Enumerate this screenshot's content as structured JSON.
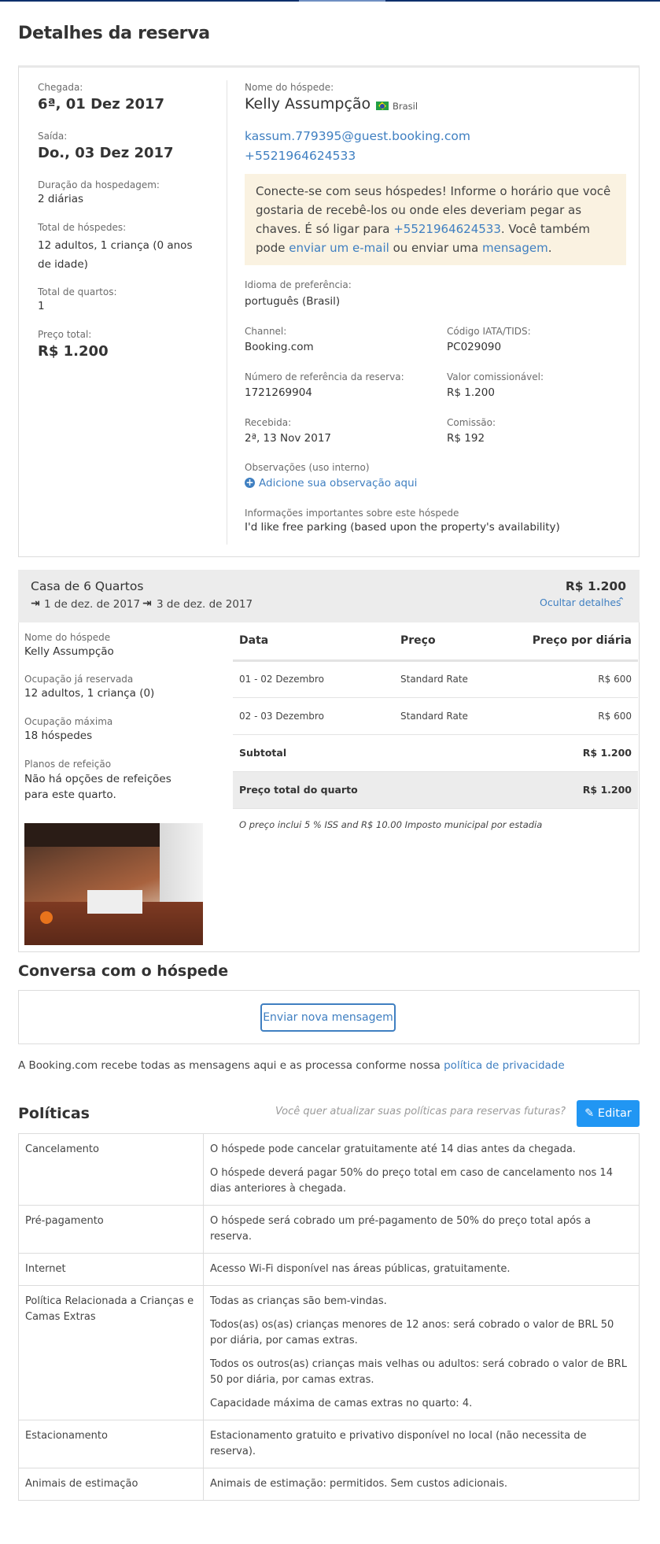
{
  "page_title": "Detalhes da reserva",
  "reservation": {
    "arrival_label": "Chegada:",
    "arrival_value": "6ª, 01 Dez 2017",
    "departure_label": "Saída:",
    "departure_value": "Do., 03 Dez 2017",
    "duration_label": "Duração da hospedagem:",
    "duration_value": "2 diárias",
    "guests_label": "Total de hóspedes:",
    "guests_value": "12 adultos, 1 criança (0 anos de idade)",
    "rooms_label": "Total de quartos:",
    "rooms_value": "1",
    "price_label": "Preço total:",
    "price_value": "R$ 1.200"
  },
  "guest": {
    "name_label": "Nome do hóspede:",
    "name": "Kelly Assumpção",
    "country": "Brasil",
    "email": "kassum.779395@guest.booking.com",
    "phone": "+5521964624533",
    "notice_pre": "Conecte-se com seus hóspedes! Informe o horário que você gostaria de recebê-los ou onde eles deveriam pegar as chaves. É só ligar para ",
    "notice_phone": "+5521964624533",
    "notice_mid": ". Você também pode ",
    "notice_email_link": "enviar um e-mail",
    "notice_or": " ou enviar uma ",
    "notice_message_link": "mensagem",
    "notice_end": ".",
    "language_label": "Idioma de preferência:",
    "language_value": "português (Brasil)",
    "channel_label": "Channel:",
    "channel_value": "Booking.com",
    "iata_label": "Código IATA/TIDS:",
    "iata_value": "PC029090",
    "ref_label": "Número de referência da reserva:",
    "ref_value": "1721269904",
    "commissionable_label": "Valor comissionável:",
    "commissionable_value": "R$ 1.200",
    "received_label": "Recebida:",
    "received_value": "2ª, 13 Nov 2017",
    "commission_label": "Comissão:",
    "commission_value": "R$ 192",
    "notes_label": "Observações (uso interno)",
    "notes_link": "Adicione sua observação aqui",
    "important_label": "Informações importantes sobre este hóspede",
    "important_value": "I'd like free parking (based upon the property's availability)"
  },
  "room": {
    "title": "Casa de 6 Quartos",
    "price": "R$ 1.200",
    "checkin": "1 de dez. de 2017",
    "checkout": "3 de dez. de 2017",
    "hide_details": "Ocultar detalhes",
    "guest_name_label": "Nome do hóspede",
    "guest_name_value": "Kelly Assumpção",
    "occupancy_label": "Ocupação já reservada",
    "occupancy_value": "12 adultos, 1 criança (0)",
    "max_label": "Ocupação máxima",
    "max_value": "18 hóspedes",
    "meals_label": "Planos de refeição",
    "meals_value": "Não há opções de refeições para este quarto.",
    "table": {
      "headers": [
        "Data",
        "Preço",
        "Preço por diária"
      ],
      "rows": [
        [
          "01 - 02 Dezembro",
          "Standard Rate",
          "R$ 600"
        ],
        [
          "02 - 03 Dezembro",
          "Standard Rate",
          "R$ 600"
        ]
      ],
      "subtotal_label": "Subtotal",
      "subtotal_value": "R$ 1.200",
      "total_label": "Preço total do quarto",
      "total_value": "R$ 1.200"
    },
    "tax_note": "O preço inclui 5 % ISS and R$ 10.00 Imposto municipal por estadia"
  },
  "conversation": {
    "title": "Conversa com o hóspede",
    "button": "Enviar nova mensagem",
    "privacy_pre": "A Booking.com recebe todas as mensagens aqui e as processa conforme nossa ",
    "privacy_link": "política de privacidade"
  },
  "policies": {
    "title": "Políticas",
    "prompt": "Você quer atualizar suas políticas para reservas futuras?",
    "edit_button": "Editar",
    "rows": [
      {
        "name": "Cancelamento",
        "lines": [
          "O hóspede pode cancelar gratuitamente até 14 dias antes da chegada.",
          "O hóspede deverá pagar 50% do preço total em caso de cancelamento nos 14 dias anteriores à chegada."
        ]
      },
      {
        "name": "Pré-pagamento",
        "lines": [
          "O hóspede será cobrado um pré-pagamento de 50% do preço total após a reserva."
        ]
      },
      {
        "name": "Internet",
        "lines": [
          "Acesso Wi-Fi disponível nas áreas públicas, gratuitamente."
        ]
      },
      {
        "name": "Política Relacionada a Crianças e Camas Extras",
        "lines": [
          "Todas as crianças são bem-vindas.",
          "Todos(as) os(as) crianças menores de 12 anos: será cobrado o valor de BRL 50 por diária, por camas extras.",
          "Todos os outros(as) crianças mais velhas ou adultos: será cobrado o valor de BRL 50 por diária, por camas extras.",
          "Capacidade máxima de camas extras no quarto: 4."
        ]
      },
      {
        "name": "Estacionamento",
        "lines": [
          "Estacionamento gratuito e privativo disponível no local (não necessita de reserva)."
        ]
      },
      {
        "name": "Animais de estimação",
        "lines": [
          "Animais de estimação: permitidos. Sem custos adicionais."
        ]
      }
    ]
  }
}
